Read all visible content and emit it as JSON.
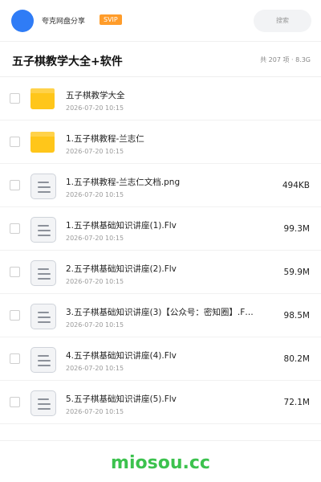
{
  "header": {
    "brand": "夸克网盘分享",
    "badge": "SVIP",
    "search_label": "搜索"
  },
  "folder": {
    "title": "五子棋教学大全+软件",
    "summary": "共 207 项 · 8.3G"
  },
  "items": [
    {
      "type": "folder",
      "name": "五子棋教学大全",
      "date": "2026-07-20 10:15",
      "size": ""
    },
    {
      "type": "folder",
      "name": "1.五子棋教程-兰志仁",
      "date": "2026-07-20 10:15",
      "size": ""
    },
    {
      "type": "file",
      "name": "1.五子棋教程-兰志仁文档.png",
      "date": "2026-07-20 10:15",
      "size": "494KB"
    },
    {
      "type": "file",
      "name": "1.五子棋基础知识讲座(1).Flv",
      "date": "2026-07-20 10:15",
      "size": "99.3M"
    },
    {
      "type": "file",
      "name": "2.五子棋基础知识讲座(2).Flv",
      "date": "2026-07-20 10:15",
      "size": "59.9M"
    },
    {
      "type": "file",
      "name": "3.五子棋基础知识讲座(3)【公众号：密知圈】.F…",
      "date": "2026-07-20 10:15",
      "size": "98.5M"
    },
    {
      "type": "file",
      "name": "4.五子棋基础知识讲座(4).Flv",
      "date": "2026-07-20 10:15",
      "size": "80.2M"
    },
    {
      "type": "file",
      "name": "5.五子棋基础知识讲座(5).Flv",
      "date": "2026-07-20 10:15",
      "size": "72.1M"
    }
  ],
  "watermark": "miosou.cc",
  "colors": {
    "accent": "#2f7cf6",
    "badge": "#ff9c2a",
    "folder": "#ffc61a",
    "watermark": "#3cc24e"
  }
}
